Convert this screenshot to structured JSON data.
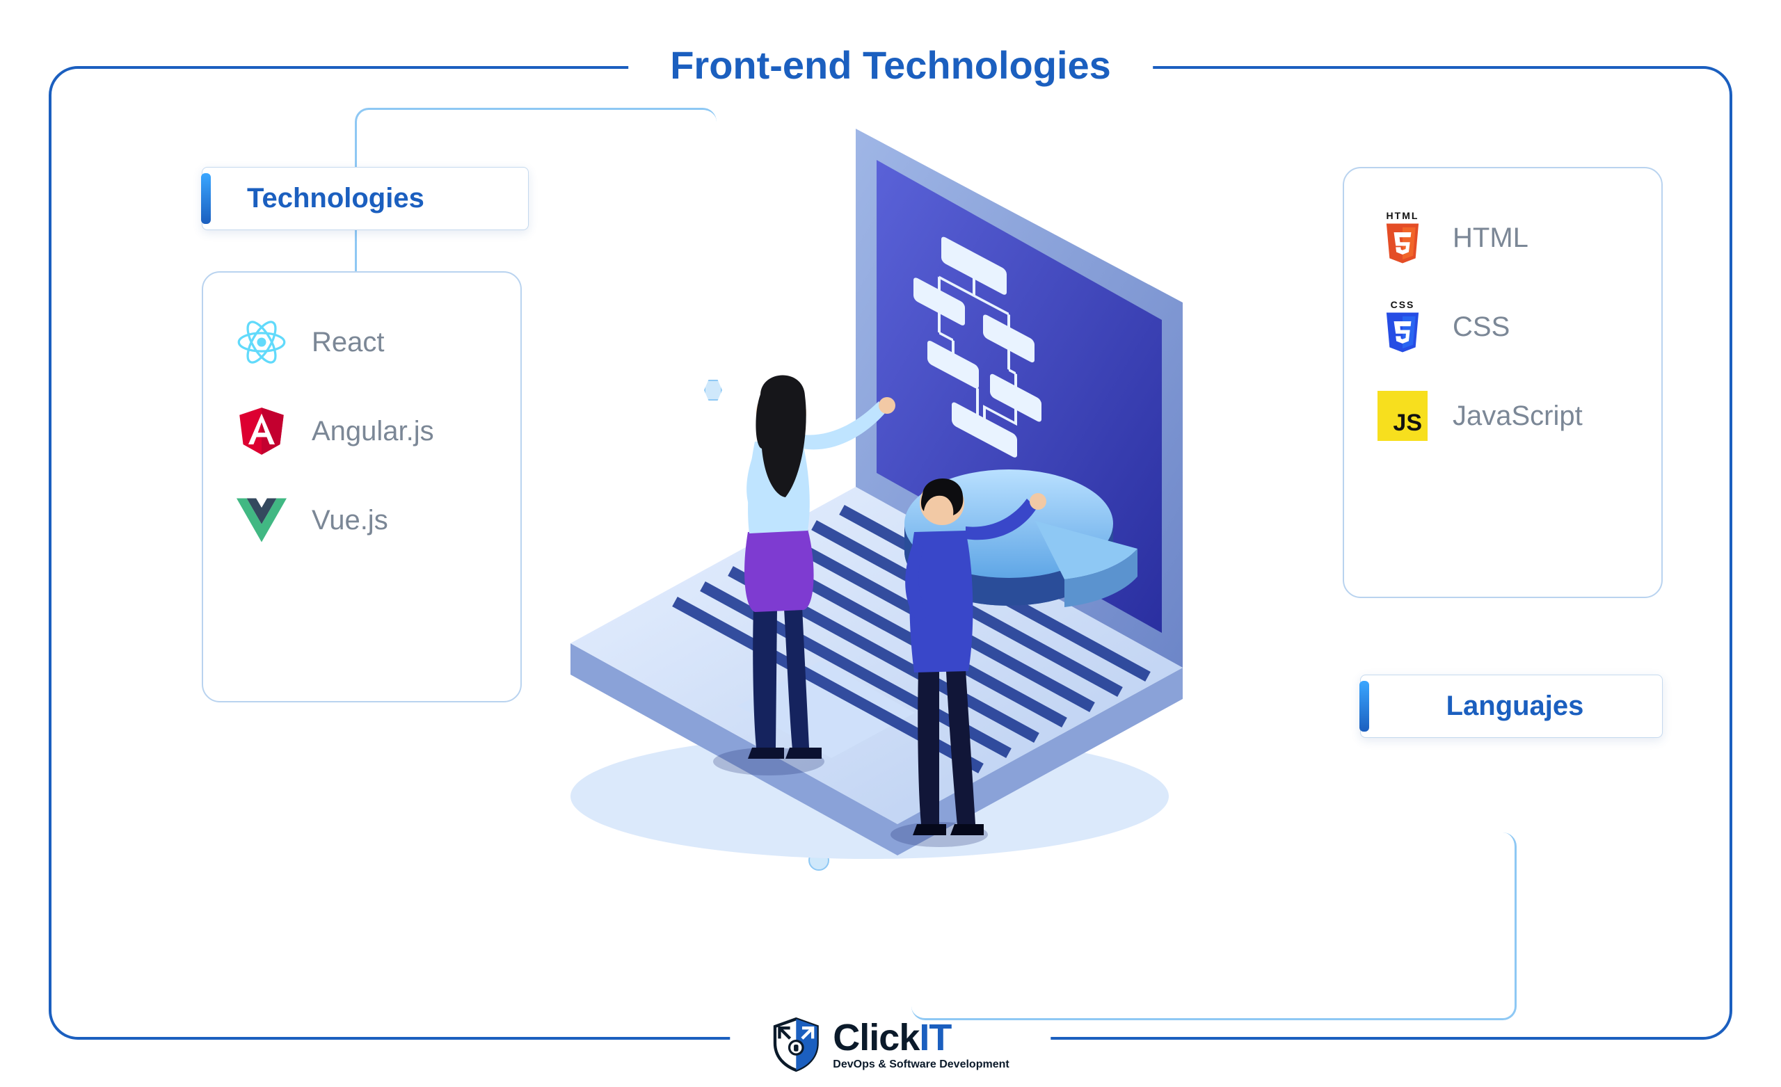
{
  "title": "Front-end Technologies",
  "labels": {
    "technologies": "Technologies",
    "languages": "Languajes"
  },
  "technologies": {
    "items": [
      {
        "icon": "react-icon",
        "name": "React"
      },
      {
        "icon": "angular-icon",
        "name": "Angular.js"
      },
      {
        "icon": "vue-icon",
        "name": "Vue.js"
      }
    ]
  },
  "languages": {
    "items": [
      {
        "icon": "html5-icon",
        "badge": "HTML",
        "name": "HTML"
      },
      {
        "icon": "css3-icon",
        "badge": "CSS",
        "name": "CSS"
      },
      {
        "icon": "javascript-icon",
        "badge": "JS",
        "name": "JavaScript"
      }
    ]
  },
  "brand": {
    "name": "ClickIT",
    "tagline": "DevOps & Software Development"
  },
  "colors": {
    "accent": "#1b5fbf",
    "connector": "#8ec8f4",
    "panel_border": "#b9d3ef",
    "text_muted": "#7b8796"
  }
}
